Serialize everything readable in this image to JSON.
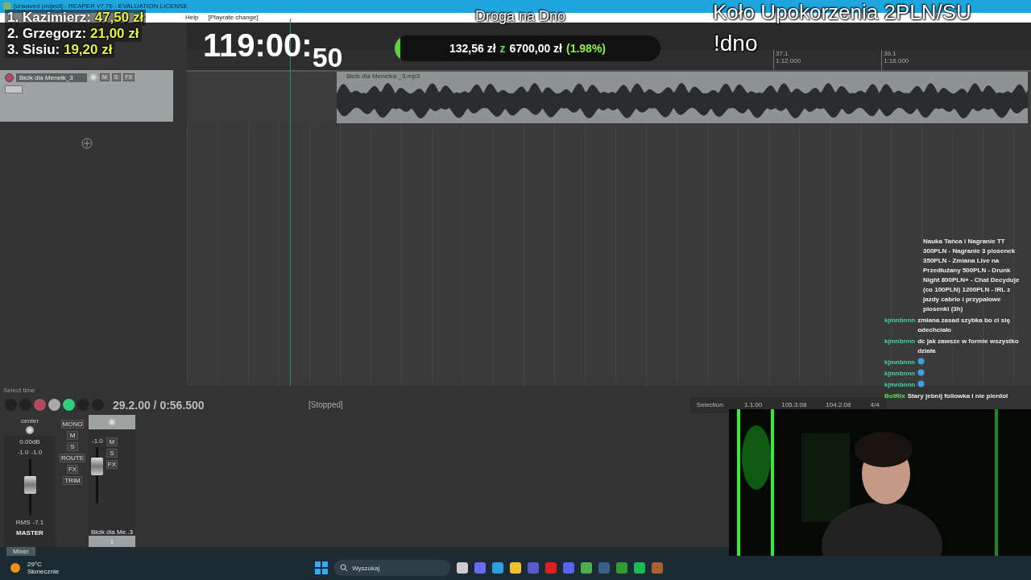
{
  "window": {
    "title": "[unsaved project] - REAPER v7.76 - EVALUATION LICENSE"
  },
  "menu": [
    {
      "label": "Help"
    },
    {
      "label": "[Playrate change]"
    }
  ],
  "ruler": [
    {
      "bar": "37.1",
      "time": "1:12.000"
    },
    {
      "bar": "39.1",
      "time": "1:16.000"
    }
  ],
  "track": {
    "name": "Bicik dla Menelk_3",
    "buttons": [
      "M",
      "S",
      "FX"
    ],
    "item": "Bicik dla Menelka _3.mp3"
  },
  "status_left": "Select time",
  "transport": {
    "position": "29.2.00 / 0:56.500",
    "state": "[Stopped]"
  },
  "selection": {
    "label": "Selection:",
    "start": "1.1.00",
    "end": "105.3.08",
    "length": "104.2.08",
    "time_signature": "4/4"
  },
  "mixer": {
    "master": {
      "pan": "center",
      "volume": "0.00dB",
      "peaks": [
        "-1.0",
        "-1.0"
      ],
      "rms_label": "RMS",
      "rms": "-7.1",
      "name": "MASTER",
      "buttons": [
        "MONO",
        "M",
        "S",
        "ROUTE",
        "FX",
        "TRIM"
      ],
      "level": 0.55
    },
    "track": {
      "peak": "-1.0",
      "buttons": [
        "M",
        "S",
        "FX"
      ],
      "name": "Bicik dla Me..3",
      "number": "1",
      "level": 0.72
    },
    "tab": "Mixer"
  },
  "overlay": {
    "leaderboard": [
      {
        "rank": "1.",
        "name": "Kazimierz:",
        "amount": "47,50 zł"
      },
      {
        "rank": "2.",
        "name": "Grzegorz:",
        "amount": "21,00 zł"
      },
      {
        "rank": "3.",
        "name": "Sisiu:",
        "amount": "19,20 zł"
      }
    ],
    "timer": "119:00:",
    "timer_seconds": "50",
    "goal": {
      "raised": "132,56 zł",
      "separator": "z",
      "target": "6700,00 zł",
      "percent": "(1.98%)",
      "level": 0.0198
    },
    "stream_title": "Droga na Dno",
    "wheel": "Koło Upokorzenia 2PLN/SU",
    "command": "!dno"
  },
  "chat": [
    {
      "text": "Nauka Tańca i Nagranie TT 300PLN - Nagranie 3 piosenek 350PLN - Zmiana Live na Przedłużany 500PLN - Drunk Night 800PLN+ - Chat Decyduje (co 100PLN) 1200PLN - IRL z jazdy cabrio i przypałowe piosenki (3h)",
      "kind": "text"
    },
    {
      "user": "kjmnbnnn",
      "color": "#3fd6a0",
      "text": "zmiana zasad szybka bo ci się odechciało",
      "kind": "text"
    },
    {
      "user": "kjmnbnnn",
      "color": "#3fd6a0",
      "text": "dc jak zawsze w formie wszystko działa",
      "kind": "text"
    },
    {
      "user": "kjmnbnnn",
      "color": "#3fd6a0",
      "kind": "emote"
    },
    {
      "user": "kjmnbnnn",
      "color": "#3fd6a0",
      "kind": "emote"
    },
    {
      "user": "kjmnbnnn",
      "color": "#3fd6a0",
      "kind": "emote"
    },
    {
      "user": "BotRix",
      "color": "#5be34a",
      "text": "Stary jebnij followka i nie pierdol",
      "kind": "text"
    }
  ],
  "taskbar": {
    "temperature": "29°C",
    "weather": "Słonecznie",
    "search": {
      "placeholder": "Wyszukaj"
    }
  }
}
